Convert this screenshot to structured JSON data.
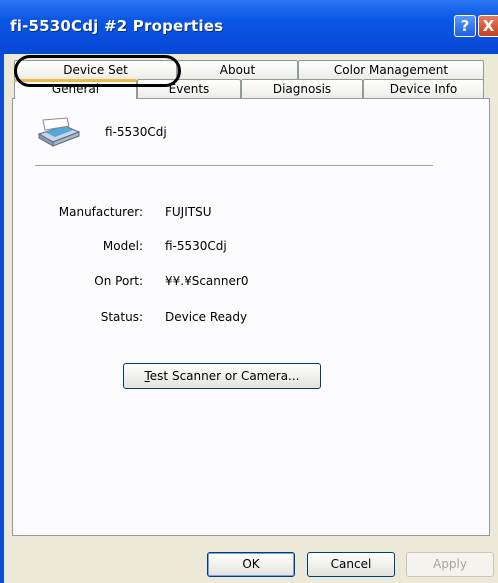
{
  "window": {
    "title": "fi-5530Cdj #2 Properties"
  },
  "title_buttons": {
    "help": "?",
    "close": "X"
  },
  "tabs_row1": [
    "Device Set",
    "About",
    "Color Management"
  ],
  "tabs_row2": [
    "General",
    "Events",
    "Diagnosis",
    "Device Info"
  ],
  "active_tab": "General",
  "device": {
    "name": "fi-5530Cdj",
    "icon": "scanner-icon"
  },
  "info": {
    "manufacturer_label": "Manufacturer:",
    "manufacturer": "FUJITSU",
    "model_label": "Model:",
    "model": "fi-5530Cdj",
    "port_label": "On Port:",
    "port": "¥¥.¥Scanner0",
    "status_label": "Status:",
    "status": "Device Ready"
  },
  "test_button": {
    "mnemonic": "T",
    "rest": "est Scanner or Camera..."
  },
  "buttons": {
    "ok": "OK",
    "cancel": "Cancel",
    "apply": "Apply"
  },
  "colors": {
    "title_bar": "#0b58e6",
    "dialog_bg": "#ece9d8",
    "active_tab_accent": "#f0b848"
  }
}
